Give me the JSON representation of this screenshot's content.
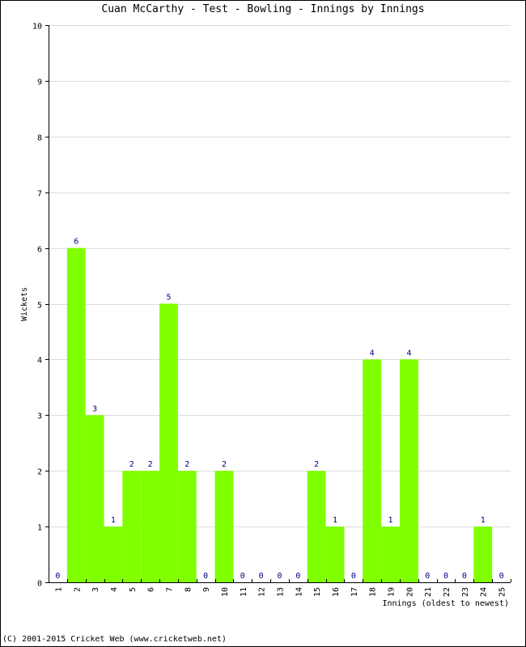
{
  "chart_data": {
    "type": "bar",
    "title": "Cuan McCarthy - Test - Bowling - Innings by Innings",
    "xlabel": "Innings (oldest to newest)",
    "ylabel": "Wickets",
    "ylim": [
      0,
      10
    ],
    "yticks": [
      "0",
      "1",
      "2",
      "3",
      "4",
      "5",
      "6",
      "7",
      "8",
      "9",
      "10"
    ],
    "grid": true,
    "categories": [
      "1",
      "2",
      "3",
      "4",
      "5",
      "6",
      "7",
      "8",
      "9",
      "10",
      "11",
      "12",
      "13",
      "14",
      "15",
      "16",
      "17",
      "18",
      "19",
      "20",
      "21",
      "22",
      "23",
      "24",
      "25"
    ],
    "values": [
      0,
      6,
      3,
      1,
      2,
      2,
      5,
      2,
      0,
      2,
      0,
      0,
      0,
      0,
      2,
      1,
      0,
      4,
      1,
      4,
      0,
      0,
      0,
      1,
      0
    ],
    "bar_color": "#80ff00",
    "value_label_color": "#000080"
  },
  "footer": "(C) 2001-2015 Cricket Web (www.cricketweb.net)"
}
